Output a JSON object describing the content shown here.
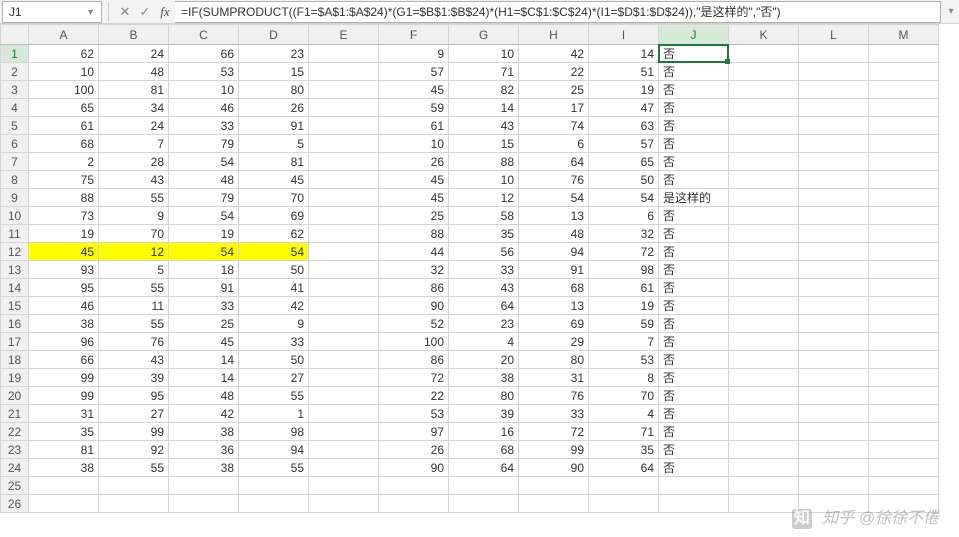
{
  "activeCell": "J1",
  "formula": "=IF(SUMPRODUCT((F1=$A$1:$A$24)*(G1=$B$1:$B$24)*(H1=$C$1:$C$24)*(I1=$D$1:$D$24)),\"是这样的\",\"否\")",
  "columns": [
    "A",
    "B",
    "C",
    "D",
    "E",
    "F",
    "G",
    "H",
    "I",
    "J",
    "K",
    "L",
    "M"
  ],
  "rowHeaders": [
    1,
    2,
    3,
    4,
    5,
    6,
    7,
    8,
    9,
    10,
    11,
    12,
    13,
    14,
    15,
    16,
    17,
    18,
    19,
    20,
    21,
    22,
    23,
    24,
    25,
    26
  ],
  "highlightRow": 12,
  "activeCol": 10,
  "activeRow": 1,
  "columnWidths": {
    "default": 70,
    "rowhead": 28
  },
  "watermark": "@徐徐不倦",
  "watermarkPrefix": "知乎",
  "rows": [
    {
      "A": 62,
      "B": 24,
      "C": 66,
      "D": 23,
      "E": "",
      "F": 9,
      "G": 10,
      "H": 42,
      "I": 14,
      "J": "否",
      "K": "",
      "L": "",
      "M": ""
    },
    {
      "A": 10,
      "B": 48,
      "C": 53,
      "D": 15,
      "E": "",
      "F": 57,
      "G": 71,
      "H": 22,
      "I": 51,
      "J": "否",
      "K": "",
      "L": "",
      "M": ""
    },
    {
      "A": 100,
      "B": 81,
      "C": 10,
      "D": 80,
      "E": "",
      "F": 45,
      "G": 82,
      "H": 25,
      "I": 19,
      "J": "否",
      "K": "",
      "L": "",
      "M": ""
    },
    {
      "A": 65,
      "B": 34,
      "C": 46,
      "D": 26,
      "E": "",
      "F": 59,
      "G": 14,
      "H": 17,
      "I": 47,
      "J": "否",
      "K": "",
      "L": "",
      "M": ""
    },
    {
      "A": 61,
      "B": 24,
      "C": 33,
      "D": 91,
      "E": "",
      "F": 61,
      "G": 43,
      "H": 74,
      "I": 63,
      "J": "否",
      "K": "",
      "L": "",
      "M": ""
    },
    {
      "A": 68,
      "B": 7,
      "C": 79,
      "D": 5,
      "E": "",
      "F": 10,
      "G": 15,
      "H": 6,
      "I": 57,
      "J": "否",
      "K": "",
      "L": "",
      "M": ""
    },
    {
      "A": 2,
      "B": 28,
      "C": 54,
      "D": 81,
      "E": "",
      "F": 26,
      "G": 88,
      "H": 64,
      "I": 65,
      "J": "否",
      "K": "",
      "L": "",
      "M": ""
    },
    {
      "A": 75,
      "B": 43,
      "C": 48,
      "D": 45,
      "E": "",
      "F": 45,
      "G": 10,
      "H": 76,
      "I": 50,
      "J": "否",
      "K": "",
      "L": "",
      "M": ""
    },
    {
      "A": 88,
      "B": 55,
      "C": 79,
      "D": 70,
      "E": "",
      "F": 45,
      "G": 12,
      "H": 54,
      "I": 54,
      "J": "是这样的",
      "K": "",
      "L": "",
      "M": ""
    },
    {
      "A": 73,
      "B": 9,
      "C": 54,
      "D": 69,
      "E": "",
      "F": 25,
      "G": 58,
      "H": 13,
      "I": 6,
      "J": "否",
      "K": "",
      "L": "",
      "M": ""
    },
    {
      "A": 19,
      "B": 70,
      "C": 19,
      "D": 62,
      "E": "",
      "F": 88,
      "G": 35,
      "H": 48,
      "I": 32,
      "J": "否",
      "K": "",
      "L": "",
      "M": ""
    },
    {
      "A": 45,
      "B": 12,
      "C": 54,
      "D": 54,
      "E": "",
      "F": 44,
      "G": 56,
      "H": 94,
      "I": 72,
      "J": "否",
      "K": "",
      "L": "",
      "M": ""
    },
    {
      "A": 93,
      "B": 5,
      "C": 18,
      "D": 50,
      "E": "",
      "F": 32,
      "G": 33,
      "H": 91,
      "I": 98,
      "J": "否",
      "K": "",
      "L": "",
      "M": ""
    },
    {
      "A": 95,
      "B": 55,
      "C": 91,
      "D": 41,
      "E": "",
      "F": 86,
      "G": 43,
      "H": 68,
      "I": 61,
      "J": "否",
      "K": "",
      "L": "",
      "M": ""
    },
    {
      "A": 46,
      "B": 11,
      "C": 33,
      "D": 42,
      "E": "",
      "F": 90,
      "G": 64,
      "H": 13,
      "I": 19,
      "J": "否",
      "K": "",
      "L": "",
      "M": ""
    },
    {
      "A": 38,
      "B": 55,
      "C": 25,
      "D": 9,
      "E": "",
      "F": 52,
      "G": 23,
      "H": 69,
      "I": 59,
      "J": "否",
      "K": "",
      "L": "",
      "M": ""
    },
    {
      "A": 96,
      "B": 76,
      "C": 45,
      "D": 33,
      "E": "",
      "F": 100,
      "G": 4,
      "H": 29,
      "I": 7,
      "J": "否",
      "K": "",
      "L": "",
      "M": ""
    },
    {
      "A": 66,
      "B": 43,
      "C": 14,
      "D": 50,
      "E": "",
      "F": 86,
      "G": 20,
      "H": 80,
      "I": 53,
      "J": "否",
      "K": "",
      "L": "",
      "M": ""
    },
    {
      "A": 99,
      "B": 39,
      "C": 14,
      "D": 27,
      "E": "",
      "F": 72,
      "G": 38,
      "H": 31,
      "I": 8,
      "J": "否",
      "K": "",
      "L": "",
      "M": ""
    },
    {
      "A": 99,
      "B": 95,
      "C": 48,
      "D": 55,
      "E": "",
      "F": 22,
      "G": 80,
      "H": 76,
      "I": 70,
      "J": "否",
      "K": "",
      "L": "",
      "M": ""
    },
    {
      "A": 31,
      "B": 27,
      "C": 42,
      "D": 1,
      "E": "",
      "F": 53,
      "G": 39,
      "H": 33,
      "I": 4,
      "J": "否",
      "K": "",
      "L": "",
      "M": ""
    },
    {
      "A": 35,
      "B": 99,
      "C": 38,
      "D": 98,
      "E": "",
      "F": 97,
      "G": 16,
      "H": 72,
      "I": 71,
      "J": "否",
      "K": "",
      "L": "",
      "M": ""
    },
    {
      "A": 81,
      "B": 92,
      "C": 36,
      "D": 94,
      "E": "",
      "F": 26,
      "G": 68,
      "H": 99,
      "I": 35,
      "J": "否",
      "K": "",
      "L": "",
      "M": ""
    },
    {
      "A": 38,
      "B": 55,
      "C": 38,
      "D": 55,
      "E": "",
      "F": 90,
      "G": 64,
      "H": 90,
      "I": 64,
      "J": "否",
      "K": "",
      "L": "",
      "M": ""
    },
    {
      "A": "",
      "B": "",
      "C": "",
      "D": "",
      "E": "",
      "F": "",
      "G": "",
      "H": "",
      "I": "",
      "J": "",
      "K": "",
      "L": "",
      "M": ""
    },
    {
      "A": "",
      "B": "",
      "C": "",
      "D": "",
      "E": "",
      "F": "",
      "G": "",
      "H": "",
      "I": "",
      "J": "",
      "K": "",
      "L": "",
      "M": ""
    }
  ],
  "textColumns": [
    "J"
  ]
}
